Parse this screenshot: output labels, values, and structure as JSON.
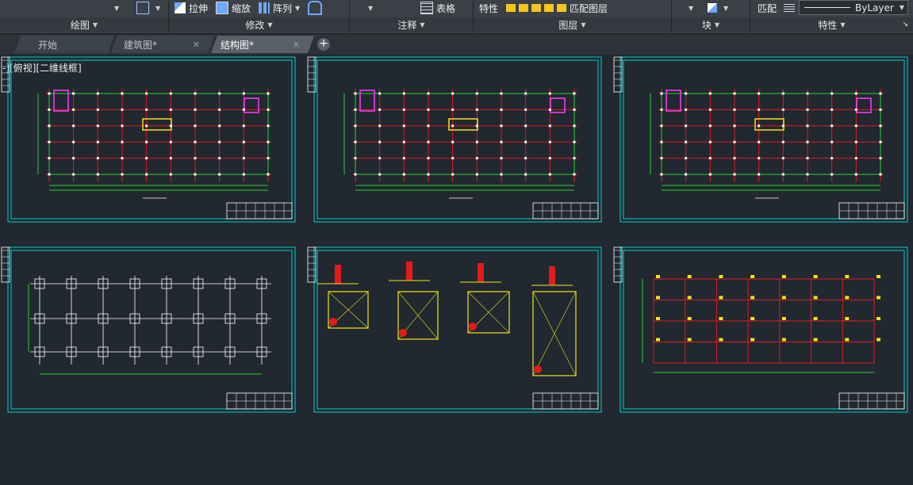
{
  "ribbon": {
    "row_items": {
      "stretch": "拉伸",
      "scale": "缩放",
      "array": "阵列",
      "table": "表格",
      "properties": "特性",
      "match_layer": "匹配图层",
      "match": "匹配",
      "bylayer": "ByLayer"
    },
    "panels": {
      "draw": "绘图",
      "modify": "修改",
      "annotation": "注释",
      "layers": "图层",
      "block": "块",
      "properties": "特性"
    }
  },
  "tabs": [
    {
      "label": "开始"
    },
    {
      "label": "建筑图*"
    },
    {
      "label": "结构图*"
    }
  ],
  "viewport": {
    "label": "-][俯视][二维线框]"
  },
  "colors": {
    "border": "#00d2d2",
    "grid_red": "#e31b1b",
    "dim_green": "#2bd12b",
    "white": "#ffffff",
    "yellow": "#f3e31a",
    "magenta": "#ff3cff"
  }
}
